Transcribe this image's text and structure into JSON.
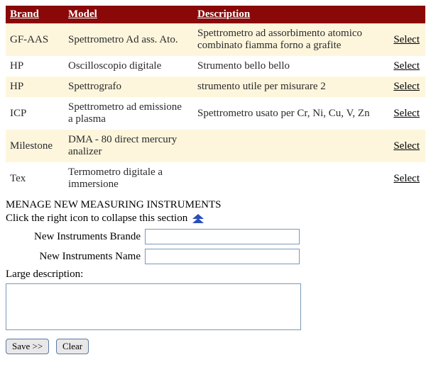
{
  "table": {
    "headers": {
      "brand": "Brand",
      "model": "Model",
      "description": "Description"
    },
    "select_label": "Select",
    "rows": [
      {
        "brand": "GF-AAS",
        "model": "Spettrometro Ad ass. Ato.",
        "description": "Spettrometro ad assorbimento atomico combinato fiamma forno a grafite"
      },
      {
        "brand": "HP",
        "model": "Oscilloscopio digitale",
        "description": "Strumento bello bello"
      },
      {
        "brand": "HP",
        "model": "Spettrografo",
        "description": "strumento utile per misurare 2"
      },
      {
        "brand": "ICP",
        "model": "Spettrometro ad emissione a plasma",
        "description": "Spettrometro usato per Cr, Ni, Cu, V, Zn"
      },
      {
        "brand": "Milestone",
        "model": "DMA - 80 direct mercury analizer",
        "description": ""
      },
      {
        "brand": "Tex",
        "model": "Termometro digitale a immersione",
        "description": ""
      }
    ]
  },
  "section": {
    "title": "MENAGE NEW MEASURING INSTRUMENTS",
    "collapse_hint": "Click the right icon to collapse this section",
    "brand_label": "New Instruments Brande",
    "name_label": "New Instruments Name",
    "desc_label": "Large description:",
    "brand_value": "",
    "name_value": "",
    "desc_value": ""
  },
  "buttons": {
    "save": "Save >>",
    "clear": "Clear"
  },
  "colors": {
    "header_bg": "#8a0808",
    "row_alt": "#fdf6dd",
    "icon": "#2a4fb8"
  }
}
